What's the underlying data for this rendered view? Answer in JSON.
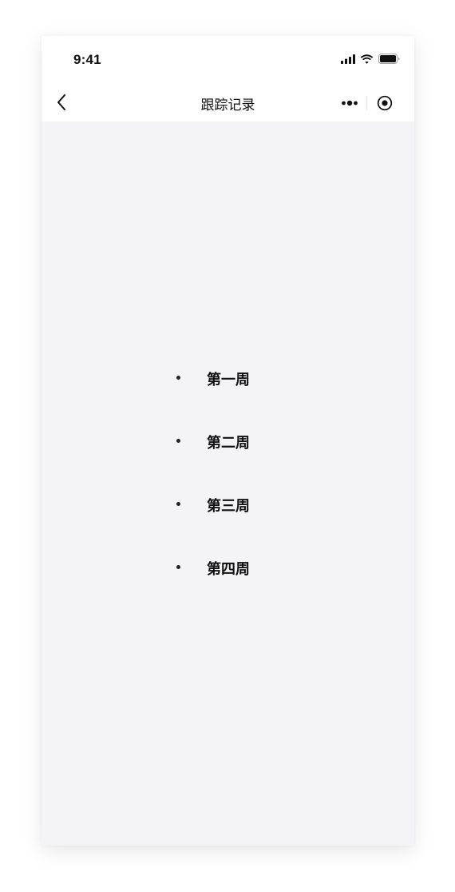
{
  "status_bar": {
    "time": "9:41",
    "icons": [
      "signal-icon",
      "wifi-icon",
      "battery-icon"
    ]
  },
  "nav": {
    "back_icon": "chevron-left-icon",
    "title": "跟踪记录",
    "capsule": {
      "more_icon": "more-dots-icon",
      "close_icon": "record-circle-icon"
    }
  },
  "weeks": [
    {
      "label": "第一周"
    },
    {
      "label": "第二周"
    },
    {
      "label": "第三周"
    },
    {
      "label": "第四周"
    }
  ],
  "colors": {
    "background": "#f4f4f6",
    "header": "#ffffff",
    "text": "#111111"
  }
}
